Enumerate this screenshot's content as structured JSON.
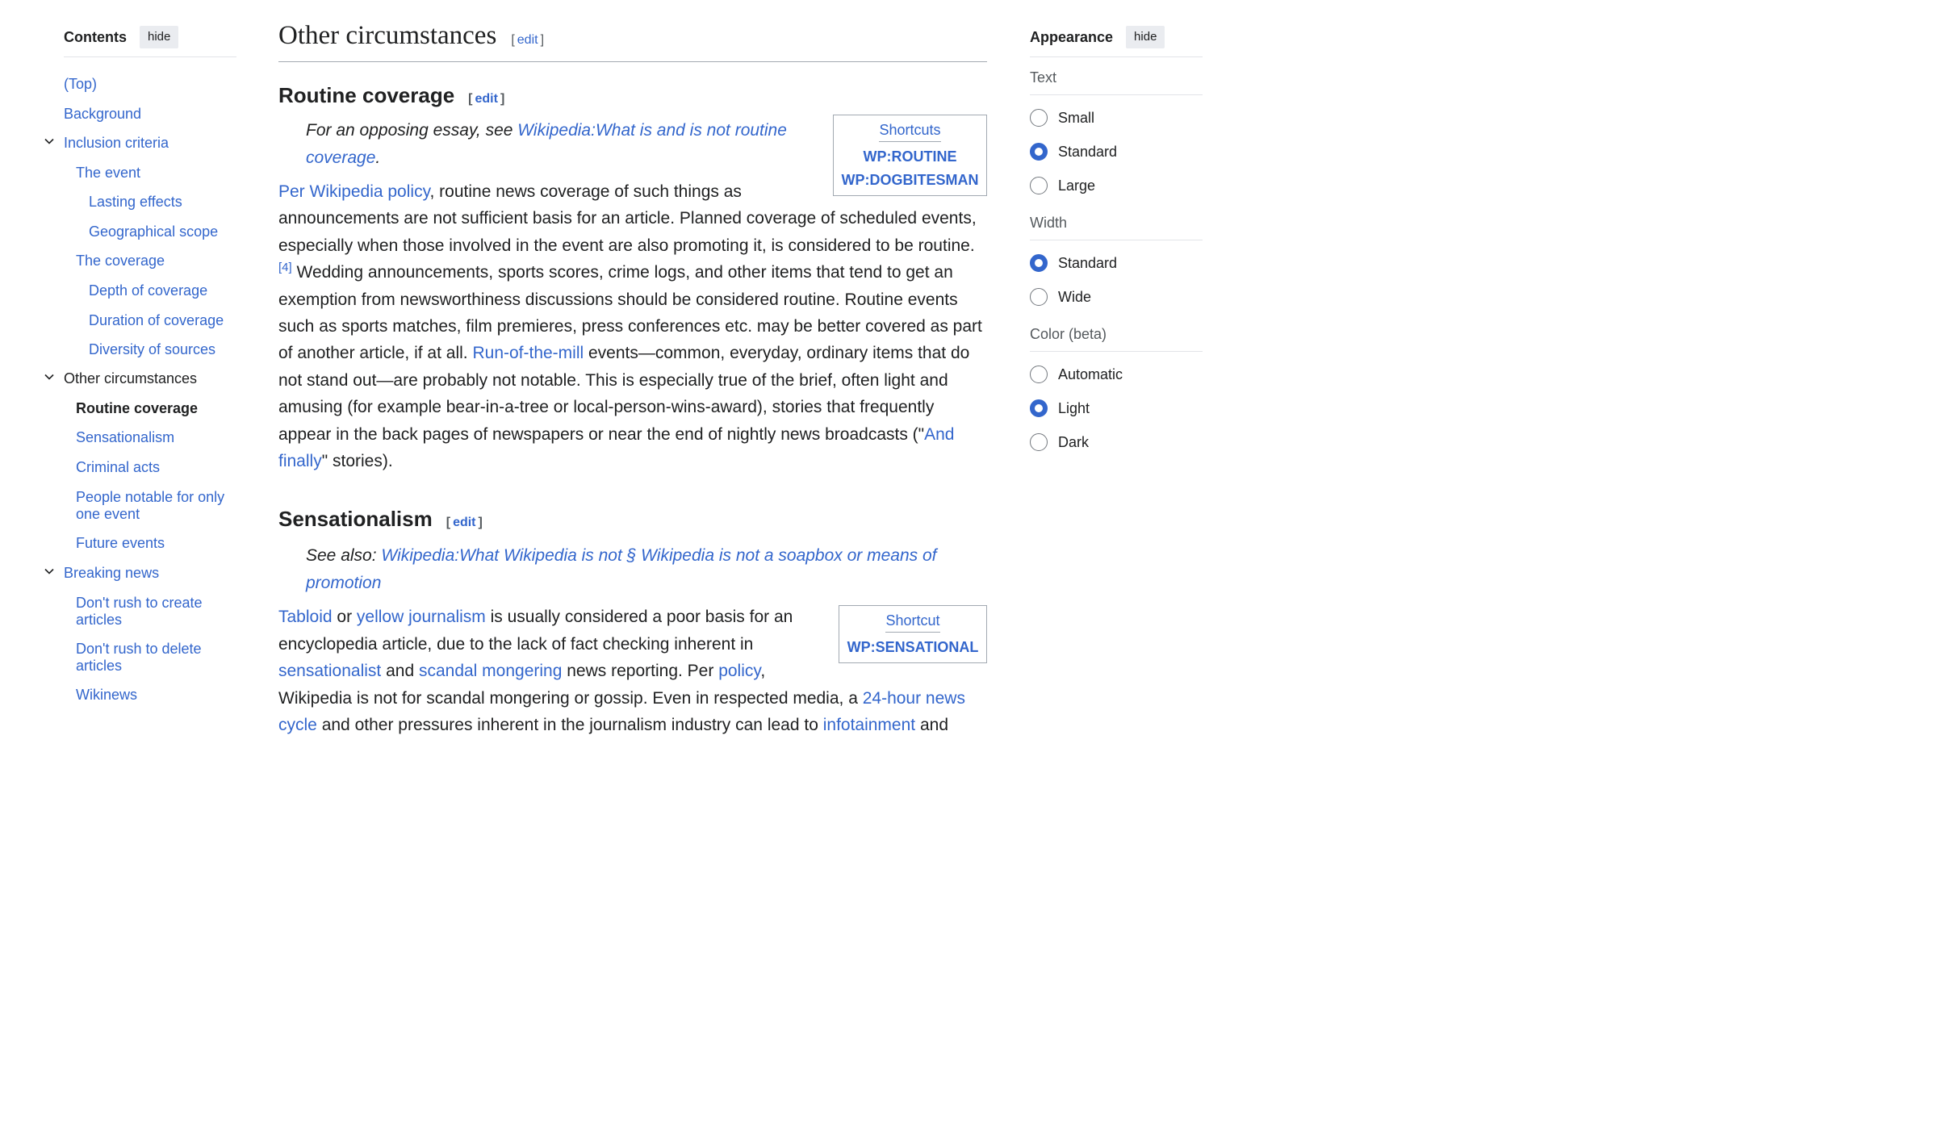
{
  "toc": {
    "title": "Contents",
    "hide_label": "hide",
    "items": [
      {
        "label": "(Top)"
      },
      {
        "label": "Background"
      },
      {
        "label": "Inclusion criteria"
      },
      {
        "label": "The event"
      },
      {
        "label": "Lasting effects"
      },
      {
        "label": "Geographical scope"
      },
      {
        "label": "The coverage"
      },
      {
        "label": "Depth of coverage"
      },
      {
        "label": "Duration of coverage"
      },
      {
        "label": "Diversity of sources"
      },
      {
        "label": "Other circumstances"
      },
      {
        "label": "Routine coverage"
      },
      {
        "label": "Sensationalism"
      },
      {
        "label": "Criminal acts"
      },
      {
        "label": "People notable for only one event"
      },
      {
        "label": "Future events"
      },
      {
        "label": "Breaking news"
      },
      {
        "label": "Don't rush to create articles"
      },
      {
        "label": "Don't rush to delete articles"
      },
      {
        "label": "Wikinews"
      }
    ]
  },
  "article": {
    "section_title": "Other circumstances",
    "edit_label": "edit",
    "routine": {
      "title": "Routine coverage",
      "hatnote_prefix": "For an opposing essay, see ",
      "hatnote_link": "Wikipedia:What is and is not routine coverage",
      "hatnote_suffix": ".",
      "shortcuts_title": "Shortcuts",
      "shortcuts": [
        "WP:ROUTINE",
        "WP:DOGBITESMAN"
      ],
      "p_link1": "Per Wikipedia policy",
      "p_text1": ", routine news coverage of such things as announcements are not sufficient basis for an article. Planned coverage of scheduled events, especially when those involved in the event are also promoting it, is considered to be routine.",
      "ref": "[4]",
      "p_text2": " Wedding announcements, sports scores, crime logs, and other items that tend to get an exemption from newsworthiness discussions should be considered routine. Routine events such as sports matches, film premieres, press conferences etc. may be better covered as part of another article, if at all. ",
      "p_link2": "Run-of-the-mill",
      "p_text3": " events—common, everyday, ordinary items that do not stand out—are probably not notable. This is especially true of the brief, often light and amusing (for example bear-in-a-tree or local-person-wins-award), stories that frequently appear in the back pages of newspapers or near the end of nightly news broadcasts (\"",
      "p_link3": "And finally",
      "p_text4": "\" stories)."
    },
    "sensationalism": {
      "title": "Sensationalism",
      "hatnote_prefix": "See also: ",
      "hatnote_link": "Wikipedia:What Wikipedia is not § Wikipedia is not a soapbox or means of promotion",
      "shortcut_title": "Shortcut",
      "shortcut": "WP:SENSATIONAL",
      "link_tabloid": "Tabloid",
      "t1": " or ",
      "link_yellow": "yellow journalism",
      "t2": " is usually considered a poor basis for an encyclopedia article, due to the lack of fact checking inherent in ",
      "link_sensationalist": "sensationalist",
      "t3": " and ",
      "link_scandal": "scandal mongering",
      "t4": " news reporting. Per ",
      "link_policy": "policy",
      "t5": ", Wikipedia is not for scandal mongering or gossip. Even in respected media, a ",
      "link_24h": "24-hour news cycle",
      "t6": " and other pressures inherent in the journalism industry can lead to ",
      "link_infotainment": "infotainment",
      "t7": " and"
    }
  },
  "appearance": {
    "title": "Appearance",
    "hide_label": "hide",
    "text_label": "Text",
    "text_options": [
      "Small",
      "Standard",
      "Large"
    ],
    "text_selected": "Standard",
    "width_label": "Width",
    "width_options": [
      "Standard",
      "Wide"
    ],
    "width_selected": "Standard",
    "color_label": "Color (beta)",
    "color_options": [
      "Automatic",
      "Light",
      "Dark"
    ],
    "color_selected": "Light"
  },
  "colors": {
    "link": "#3366cc",
    "text": "#202122",
    "muted": "#54595d",
    "border": "#a2a9b1"
  }
}
